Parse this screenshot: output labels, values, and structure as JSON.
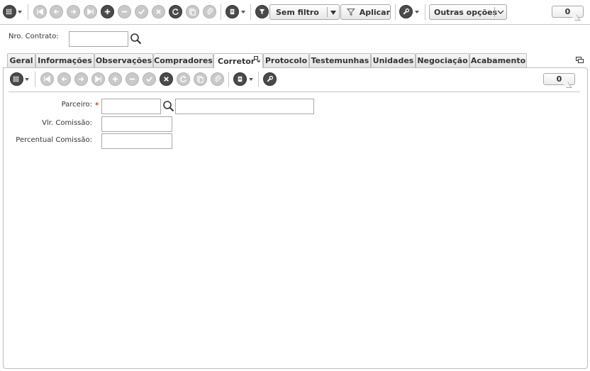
{
  "top_toolbar": {
    "filter_value": "Sem filtro",
    "apply_label": "Aplicar",
    "more_options_label": "Outras opções",
    "counter_value": "0"
  },
  "contract": {
    "label": "Nro. Contrato:",
    "value": ""
  },
  "tabs": [
    {
      "label": "Geral",
      "active": false
    },
    {
      "label": "Informações",
      "active": false
    },
    {
      "label": "Observações",
      "active": false
    },
    {
      "label": "Compradores",
      "active": false
    },
    {
      "label": "Corretor",
      "active": true
    },
    {
      "label": "Protocolo",
      "active": false
    },
    {
      "label": "Testemunhas",
      "active": false
    },
    {
      "label": "Unidades",
      "active": false
    },
    {
      "label": "Negociação",
      "active": false
    },
    {
      "label": "Acabamento",
      "active": false
    }
  ],
  "inner_toolbar": {
    "counter_value": "0"
  },
  "form": {
    "partner_label": "Parceiro:",
    "partner_code": "",
    "partner_name": "",
    "required_marker": "*",
    "commission_value_label": "Vlr. Comissão:",
    "commission_value": "",
    "commission_percent_label": "Percentual Comissão:",
    "commission_percent": ""
  },
  "colors": {
    "icon_disabled": "#c9c9c9",
    "icon_active": "#4a4a4a",
    "required": "#cc0000",
    "border": "#a9a9a9"
  }
}
